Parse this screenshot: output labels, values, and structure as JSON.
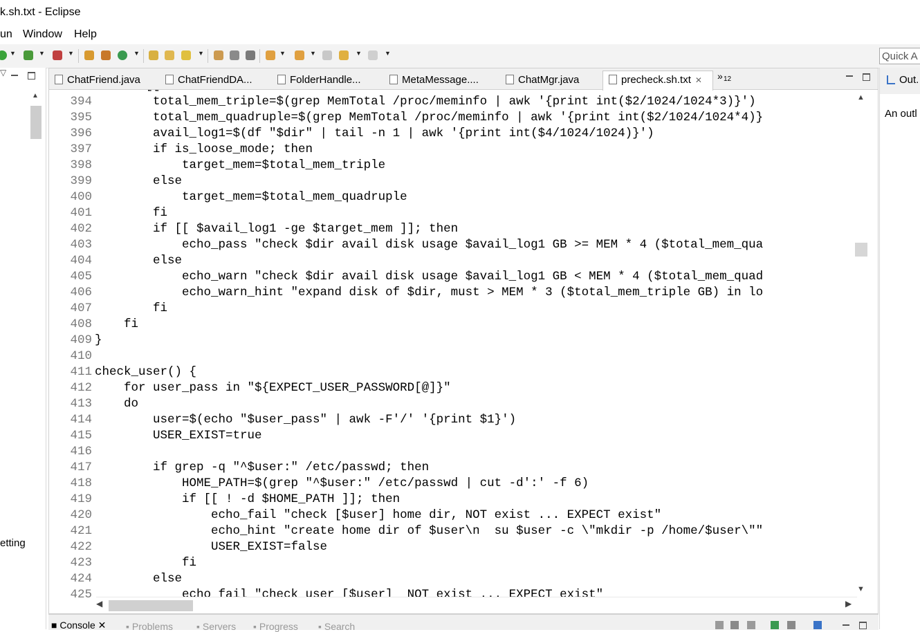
{
  "window": {
    "title": "k.sh.txt - Eclipse"
  },
  "menu": {
    "items": [
      "un",
      "Window",
      "Help"
    ]
  },
  "toolbar": {
    "quick_access_placeholder": "Quick A"
  },
  "editor": {
    "tabs": [
      {
        "label": "ChatFriend.java"
      },
      {
        "label": "ChatFriendDA..."
      },
      {
        "label": "FolderHandle..."
      },
      {
        "label": "MetaMessage...."
      },
      {
        "label": "ChatMgr.java"
      },
      {
        "label": "precheck.sh.txt",
        "active": true
      }
    ],
    "overflow_marker": "»",
    "overflow_count": "12",
    "lines": [
      {
        "n": "394",
        "t": "        total_mem_triple=$(grep MemTotal /proc/meminfo | awk '{print int($2/1024/1024*3)}')"
      },
      {
        "n": "395",
        "t": "        total_mem_quadruple=$(grep MemTotal /proc/meminfo | awk '{print int($2/1024/1024*4)}"
      },
      {
        "n": "396",
        "t": "        avail_log1=$(df \"$dir\" | tail -n 1 | awk '{print int($4/1024/1024)}')"
      },
      {
        "n": "397",
        "t": "        if is_loose_mode; then"
      },
      {
        "n": "398",
        "t": "            target_mem=$total_mem_triple"
      },
      {
        "n": "399",
        "t": "        else"
      },
      {
        "n": "400",
        "t": "            target_mem=$total_mem_quadruple"
      },
      {
        "n": "401",
        "t": "        fi"
      },
      {
        "n": "402",
        "t": "        if [[ $avail_log1 -ge $target_mem ]]; then"
      },
      {
        "n": "403",
        "t": "            echo_pass \"check $dir avail disk usage $avail_log1 GB >= MEM * 4 ($total_mem_qua"
      },
      {
        "n": "404",
        "t": "        else"
      },
      {
        "n": "405",
        "t": "            echo_warn \"check $dir avail disk usage $avail_log1 GB < MEM * 4 ($total_mem_quad"
      },
      {
        "n": "406",
        "t": "            echo_warn_hint \"expand disk of $dir, must > MEM * 3 ($total_mem_triple GB) in lo"
      },
      {
        "n": "407",
        "t": "        fi"
      },
      {
        "n": "408",
        "t": "    fi"
      },
      {
        "n": "409",
        "t": "}"
      },
      {
        "n": "410",
        "t": ""
      },
      {
        "n": "411",
        "t": "check_user() {"
      },
      {
        "n": "412",
        "t": "    for user_pass in \"${EXPECT_USER_PASSWORD[@]}\""
      },
      {
        "n": "413",
        "t": "    do"
      },
      {
        "n": "414",
        "t": "        user=$(echo \"$user_pass\" | awk -F'/' '{print $1}')"
      },
      {
        "n": "415",
        "t": "        USER_EXIST=true"
      },
      {
        "n": "416",
        "t": ""
      },
      {
        "n": "417",
        "t": "        if grep -q \"^$user:\" /etc/passwd; then"
      },
      {
        "n": "418",
        "t": "            HOME_PATH=$(grep \"^$user:\" /etc/passwd | cut -d':' -f 6)"
      },
      {
        "n": "419",
        "t": "            if [[ ! -d $HOME_PATH ]]; then"
      },
      {
        "n": "420",
        "t": "                echo_fail \"check [$user] home dir, NOT exist ... EXPECT exist\""
      },
      {
        "n": "421",
        "t": "                echo_hint \"create home dir of $user\\n  su $user -c \\\"mkdir -p /home/$user\\\"\""
      },
      {
        "n": "422",
        "t": "                USER_EXIST=false"
      },
      {
        "n": "423",
        "t": "            fi"
      },
      {
        "n": "424",
        "t": "        else"
      },
      {
        "n": "425",
        "t": "            echo_fail \"check user [$user]  NOT exist ... EXPECT exist\""
      }
    ]
  },
  "left_panel": {
    "partial_label": "etting"
  },
  "right_panel": {
    "tab_label": "Out.",
    "content_text": "An outl"
  },
  "bottom_panel": {
    "tabs": [
      "Console",
      "Problems",
      "Servers",
      "Progress",
      "Search"
    ]
  },
  "colors": {
    "accent": "#3a73c7",
    "line_numbers": "#787878",
    "misspell_underline": "#e03030"
  }
}
